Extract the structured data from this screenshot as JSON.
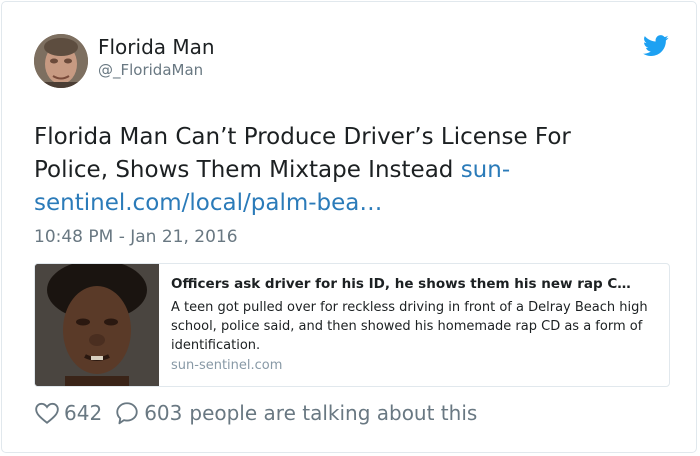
{
  "author": {
    "name": "Florida Man",
    "handle": "@_FloridaMan"
  },
  "tweet": {
    "text": "Florida Man Can’t Produce Driver’s License For Police, Shows Them Mixtape Instead",
    "link_text": "sun-sentinel.com/local/palm-bea…",
    "timestamp": "10:48 PM - Jan 21, 2016"
  },
  "link_card": {
    "title": "Officers ask driver for his ID, he shows them his new rap C…",
    "description": "A teen got pulled over for reckless driving in front of a Delray Beach high school, police said, and then showed his homemade rap CD as a form of identification.",
    "domain": "sun-sentinel.com"
  },
  "footer": {
    "likes": "642",
    "replies_count": "603",
    "talking_text": "people are talking about this"
  },
  "colors": {
    "twitter_blue": "#1da1f2",
    "link": "#2b7bb9",
    "secondary_text": "#697882",
    "border": "#e1e8ed"
  },
  "icons": {
    "brand": "twitter-bird-icon",
    "like": "heart-icon",
    "reply": "speech-bubble-icon"
  }
}
